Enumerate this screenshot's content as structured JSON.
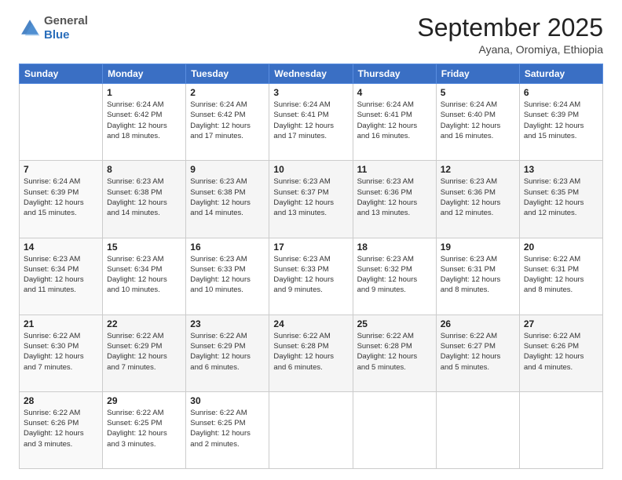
{
  "logo": {
    "general": "General",
    "blue": "Blue"
  },
  "header": {
    "month": "September 2025",
    "subtitle": "Ayana, Oromiya, Ethiopia"
  },
  "days_of_week": [
    "Sunday",
    "Monday",
    "Tuesday",
    "Wednesday",
    "Thursday",
    "Friday",
    "Saturday"
  ],
  "weeks": [
    [
      {
        "num": "",
        "info": ""
      },
      {
        "num": "1",
        "info": "Sunrise: 6:24 AM\nSunset: 6:42 PM\nDaylight: 12 hours\nand 18 minutes."
      },
      {
        "num": "2",
        "info": "Sunrise: 6:24 AM\nSunset: 6:42 PM\nDaylight: 12 hours\nand 17 minutes."
      },
      {
        "num": "3",
        "info": "Sunrise: 6:24 AM\nSunset: 6:41 PM\nDaylight: 12 hours\nand 17 minutes."
      },
      {
        "num": "4",
        "info": "Sunrise: 6:24 AM\nSunset: 6:41 PM\nDaylight: 12 hours\nand 16 minutes."
      },
      {
        "num": "5",
        "info": "Sunrise: 6:24 AM\nSunset: 6:40 PM\nDaylight: 12 hours\nand 16 minutes."
      },
      {
        "num": "6",
        "info": "Sunrise: 6:24 AM\nSunset: 6:39 PM\nDaylight: 12 hours\nand 15 minutes."
      }
    ],
    [
      {
        "num": "7",
        "info": "Sunrise: 6:24 AM\nSunset: 6:39 PM\nDaylight: 12 hours\nand 15 minutes."
      },
      {
        "num": "8",
        "info": "Sunrise: 6:23 AM\nSunset: 6:38 PM\nDaylight: 12 hours\nand 14 minutes."
      },
      {
        "num": "9",
        "info": "Sunrise: 6:23 AM\nSunset: 6:38 PM\nDaylight: 12 hours\nand 14 minutes."
      },
      {
        "num": "10",
        "info": "Sunrise: 6:23 AM\nSunset: 6:37 PM\nDaylight: 12 hours\nand 13 minutes."
      },
      {
        "num": "11",
        "info": "Sunrise: 6:23 AM\nSunset: 6:36 PM\nDaylight: 12 hours\nand 13 minutes."
      },
      {
        "num": "12",
        "info": "Sunrise: 6:23 AM\nSunset: 6:36 PM\nDaylight: 12 hours\nand 12 minutes."
      },
      {
        "num": "13",
        "info": "Sunrise: 6:23 AM\nSunset: 6:35 PM\nDaylight: 12 hours\nand 12 minutes."
      }
    ],
    [
      {
        "num": "14",
        "info": "Sunrise: 6:23 AM\nSunset: 6:34 PM\nDaylight: 12 hours\nand 11 minutes."
      },
      {
        "num": "15",
        "info": "Sunrise: 6:23 AM\nSunset: 6:34 PM\nDaylight: 12 hours\nand 10 minutes."
      },
      {
        "num": "16",
        "info": "Sunrise: 6:23 AM\nSunset: 6:33 PM\nDaylight: 12 hours\nand 10 minutes."
      },
      {
        "num": "17",
        "info": "Sunrise: 6:23 AM\nSunset: 6:33 PM\nDaylight: 12 hours\nand 9 minutes."
      },
      {
        "num": "18",
        "info": "Sunrise: 6:23 AM\nSunset: 6:32 PM\nDaylight: 12 hours\nand 9 minutes."
      },
      {
        "num": "19",
        "info": "Sunrise: 6:23 AM\nSunset: 6:31 PM\nDaylight: 12 hours\nand 8 minutes."
      },
      {
        "num": "20",
        "info": "Sunrise: 6:22 AM\nSunset: 6:31 PM\nDaylight: 12 hours\nand 8 minutes."
      }
    ],
    [
      {
        "num": "21",
        "info": "Sunrise: 6:22 AM\nSunset: 6:30 PM\nDaylight: 12 hours\nand 7 minutes."
      },
      {
        "num": "22",
        "info": "Sunrise: 6:22 AM\nSunset: 6:29 PM\nDaylight: 12 hours\nand 7 minutes."
      },
      {
        "num": "23",
        "info": "Sunrise: 6:22 AM\nSunset: 6:29 PM\nDaylight: 12 hours\nand 6 minutes."
      },
      {
        "num": "24",
        "info": "Sunrise: 6:22 AM\nSunset: 6:28 PM\nDaylight: 12 hours\nand 6 minutes."
      },
      {
        "num": "25",
        "info": "Sunrise: 6:22 AM\nSunset: 6:28 PM\nDaylight: 12 hours\nand 5 minutes."
      },
      {
        "num": "26",
        "info": "Sunrise: 6:22 AM\nSunset: 6:27 PM\nDaylight: 12 hours\nand 5 minutes."
      },
      {
        "num": "27",
        "info": "Sunrise: 6:22 AM\nSunset: 6:26 PM\nDaylight: 12 hours\nand 4 minutes."
      }
    ],
    [
      {
        "num": "28",
        "info": "Sunrise: 6:22 AM\nSunset: 6:26 PM\nDaylight: 12 hours\nand 3 minutes."
      },
      {
        "num": "29",
        "info": "Sunrise: 6:22 AM\nSunset: 6:25 PM\nDaylight: 12 hours\nand 3 minutes."
      },
      {
        "num": "30",
        "info": "Sunrise: 6:22 AM\nSunset: 6:25 PM\nDaylight: 12 hours\nand 2 minutes."
      },
      {
        "num": "",
        "info": ""
      },
      {
        "num": "",
        "info": ""
      },
      {
        "num": "",
        "info": ""
      },
      {
        "num": "",
        "info": ""
      }
    ]
  ]
}
